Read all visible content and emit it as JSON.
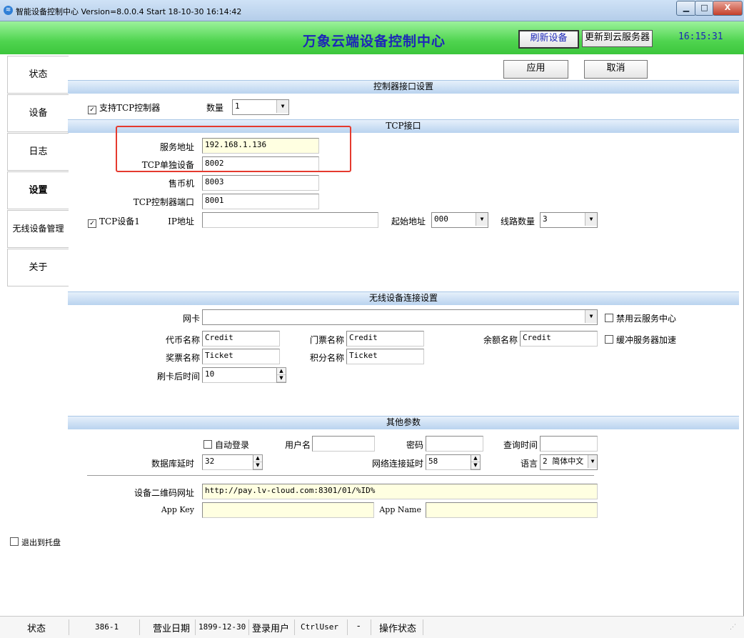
{
  "window": {
    "title": "智能设备控制中心 Version=8.0.0.4 Start 18-10-30 16:14:42",
    "controls": {
      "minimize": "▁",
      "maximize": "□",
      "close": "X"
    }
  },
  "header": {
    "app_title": "万象云端设备控制中心",
    "refresh_label": "刷新设备",
    "update_label": "更新到云服务器",
    "clock": "16:15:31"
  },
  "sidebar": {
    "items": [
      {
        "label": "状态"
      },
      {
        "label": "设备"
      },
      {
        "label": "日志"
      },
      {
        "label": "设置"
      },
      {
        "label": "无线设备管理"
      },
      {
        "label": "关于"
      }
    ],
    "exit_tray_label": "退出到托盘"
  },
  "actions": {
    "apply_label": "应用",
    "cancel_label": "取消"
  },
  "controller": {
    "section_title": "控制器接口设置",
    "support_tcp_label": "支持TCP控制器",
    "count_label": "数量",
    "count_value": "1"
  },
  "tcp": {
    "section_title": "TCP接口",
    "server_addr_label": "服务地址",
    "server_addr_value": "192.168.1.136",
    "single_device_label": "TCP单独设备",
    "single_device_value": "8002",
    "coin_machine_label": "售币机",
    "coin_machine_value": "8003",
    "controller_port_label": "TCP控制器端口",
    "controller_port_value": "8001",
    "device1_label": "TCP设备1",
    "ip_label": "IP地址",
    "ip_value": "",
    "start_addr_label": "起始地址",
    "start_addr_value": "000",
    "lines_label": "线路数量",
    "lines_value": "3"
  },
  "wireless": {
    "section_title": "无线设备连接设置",
    "nic_label": "网卡",
    "nic_value": "",
    "disable_cloud_label": "禁用云服务中心",
    "buffer_accel_label": "缓冲服务器加速",
    "coin_name_label": "代币名称",
    "coin_name_value": "Credit",
    "ticket_name_label": "门票名称",
    "ticket_name_value": "Credit",
    "balance_name_label": "余额名称",
    "balance_name_value": "Credit",
    "lottery_name_label": "奖票名称",
    "lottery_name_value": "Ticket",
    "points_name_label": "积分名称",
    "points_name_value": "Ticket",
    "swipe_time_label": "刷卡后时间",
    "swipe_time_value": "10"
  },
  "other": {
    "section_title": "其他参数",
    "auto_login_label": "自动登录",
    "username_label": "用户名",
    "username_value": "",
    "password_label": "密码",
    "password_value": "",
    "query_time_label": "查询时间",
    "query_time_value": "",
    "db_delay_label": "数据库延时",
    "db_delay_value": "32",
    "net_delay_label": "网络连接延时",
    "net_delay_value": "58",
    "language_label": "语言",
    "language_value": "2 简体中文",
    "qr_url_label": "设备二维码网址",
    "qr_url_value": "http://pay.lv-cloud.com:8301/01/%ID%",
    "app_key_label": "App Key",
    "app_key_value": "",
    "app_name_label": "App Name",
    "app_name_value": ""
  },
  "statusbar": {
    "status_label": "状态",
    "code": "386-1",
    "business_date_label": "营业日期",
    "business_date": "1899-12-30",
    "login_user_label": "登录用户",
    "login_user": "CtrlUser",
    "dash": "-",
    "op_status_label": "操作状态"
  },
  "colors": {
    "header_green": "#4fd44f",
    "title_blue": "#1d27b8",
    "highlight_red": "#e53a2e",
    "section_blue": "#b9d3ef"
  }
}
